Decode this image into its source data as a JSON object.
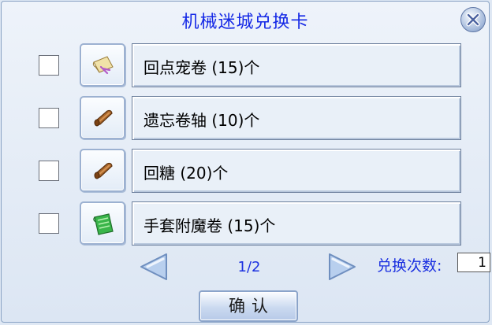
{
  "dialog": {
    "title": "机械迷城兑换卡"
  },
  "items": [
    {
      "label": "回点宠卷 (15)个",
      "icon": "scroll-ribbon-icon"
    },
    {
      "label": "遗忘卷轴 (10)个",
      "icon": "scroll-icon"
    },
    {
      "label": "回糖 (20)个",
      "icon": "scroll-icon"
    },
    {
      "label": "手套附魔卷 (15)个",
      "icon": "green-scroll-icon"
    }
  ],
  "pagination": {
    "page": "1/2"
  },
  "exchange": {
    "label": "兑换次数:",
    "value": "1"
  },
  "confirm_label": "确认",
  "colors": {
    "title": "#1428e6",
    "accent_text": "#1b30e0",
    "panel": "#e9f0f8"
  }
}
